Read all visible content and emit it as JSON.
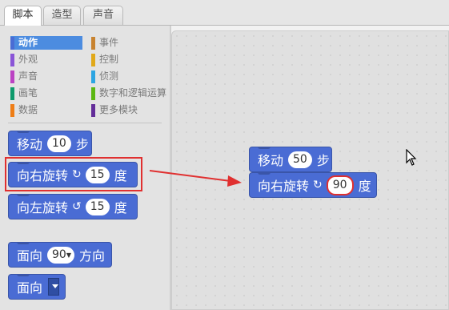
{
  "tabs": [
    {
      "label": "脚本",
      "active": true
    },
    {
      "label": "造型",
      "active": false
    },
    {
      "label": "声音",
      "active": false
    }
  ],
  "categories": [
    {
      "label": "动作",
      "color": "#4a6cd4",
      "selected": true
    },
    {
      "label": "外观",
      "color": "#8a55d7",
      "selected": false
    },
    {
      "label": "声音",
      "color": "#bb42c3",
      "selected": false
    },
    {
      "label": "画笔",
      "color": "#0e9a6c",
      "selected": false
    },
    {
      "label": "数据",
      "color": "#ee7d16",
      "selected": false
    },
    {
      "label": "事件",
      "color": "#c88330",
      "selected": false
    },
    {
      "label": "控制",
      "color": "#e1a91a",
      "selected": false
    },
    {
      "label": "侦测",
      "color": "#2ca5e2",
      "selected": false
    },
    {
      "label": "数字和逻辑运算",
      "color": "#5cb712",
      "selected": false
    },
    {
      "label": "更多模块",
      "color": "#632d99",
      "selected": false
    }
  ],
  "palette_blocks": {
    "move": {
      "label": "移动",
      "value": "10",
      "unit": "步"
    },
    "turn_right": {
      "label": "向右旋转",
      "icon": "↻",
      "value": "15",
      "unit": "度"
    },
    "turn_left": {
      "label": "向左旋转",
      "icon": "↺",
      "value": "15",
      "unit": "度"
    },
    "point_direction": {
      "label": "面向",
      "value": "90",
      "unit": "方向"
    },
    "point_towards": {
      "label": "面向"
    }
  },
  "script_blocks": {
    "move": {
      "label": "移动",
      "value": "50",
      "unit": "步"
    },
    "turn_right": {
      "label": "向右旋转",
      "icon": "↻",
      "value": "90",
      "unit": "度"
    }
  },
  "colors": {
    "motion_block": "#4a6cd4",
    "highlight": "#e03030",
    "selected_category": "#4c8ce0"
  }
}
